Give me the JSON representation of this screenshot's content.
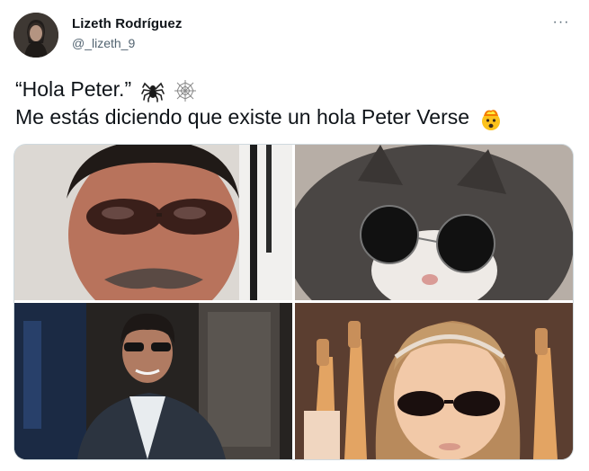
{
  "tweet": {
    "author_name": "Lizeth Rodríguez",
    "author_handle": "@_lizeth_9",
    "text_line1": "“Hola Peter.”",
    "text_line2": "Me estás diciendo que existe un hola Peter Verse",
    "more_label": "···"
  },
  "icons": {
    "line1_emojis": [
      "spider-icon",
      "spider-web-icon"
    ],
    "line2_emoji": "exploding-head-icon"
  },
  "media": {
    "images": [
      {
        "subject": "man-sunglasses-selfie"
      },
      {
        "subject": "cat-round-sunglasses"
      },
      {
        "subject": "man-suit-sunglasses"
      },
      {
        "subject": "girl-sunglasses-guitars"
      }
    ]
  },
  "colors": {
    "text_primary": "#0f1419",
    "text_secondary": "#536471",
    "border": "#cfd9de"
  }
}
